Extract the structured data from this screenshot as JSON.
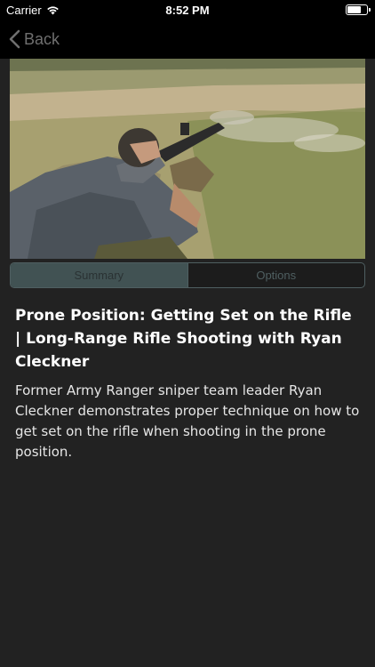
{
  "status_bar": {
    "carrier": "Carrier",
    "time": "8:52 PM",
    "battery_level": 0.7,
    "wifi_icon": "wifi-icon",
    "battery_icon": "battery-icon"
  },
  "nav": {
    "back_label": "Back",
    "back_icon": "chevron-left-icon"
  },
  "hero": {
    "icon": "video-thumbnail"
  },
  "tabs": [
    {
      "label": "Summary",
      "selected": true
    },
    {
      "label": "Options",
      "selected": false
    }
  ],
  "content": {
    "title": "Prone Position: Getting Set on the Rifle | Long-Range Rifle Shooting with Ryan Cleckner",
    "description": "Former Army Ranger sniper team leader Ryan Cleckner demonstrates proper technique on how to get set on the rifle when shooting in the prone position."
  },
  "colors": {
    "background": "#222222",
    "bar": "#000000",
    "accent": "#415253",
    "back_text": "#6f6f6f"
  }
}
